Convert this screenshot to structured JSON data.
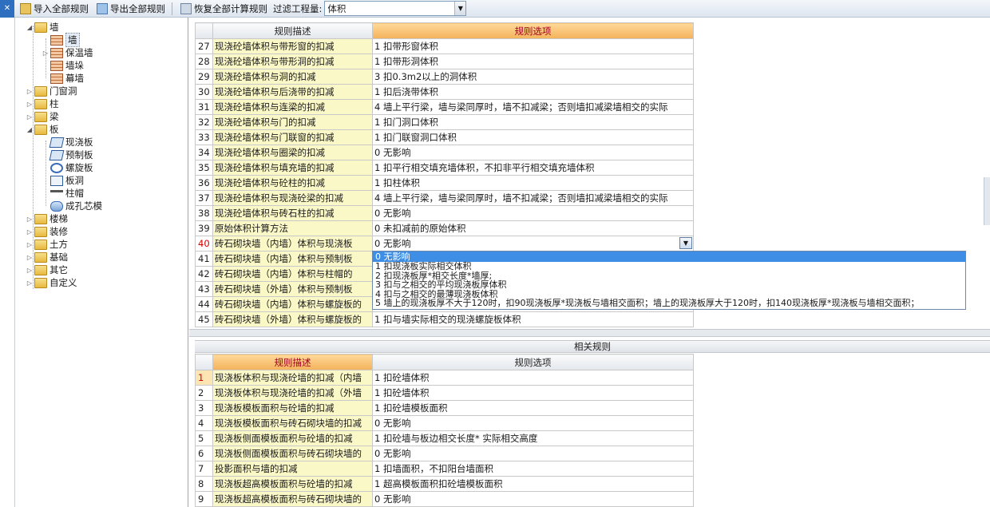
{
  "toolbar": {
    "import_label": "导入全部规则",
    "export_label": "导出全部规则",
    "restore_label": "恢复全部计算规则",
    "filter_label": "过滤工程量:",
    "filter_value": "体积"
  },
  "tree": {
    "wall": "墙",
    "wall_children": [
      "墙",
      "保温墙",
      "墙垛",
      "幕墙"
    ],
    "door_window": "门窗洞",
    "column": "柱",
    "beam": "梁",
    "slab": "板",
    "slab_children": [
      "现浇板",
      "预制板",
      "螺旋板",
      "板洞",
      "柱帽",
      "成孔芯模"
    ],
    "stairs": "楼梯",
    "decoration": "装修",
    "earthwork": "土方",
    "foundation": "基础",
    "other": "其它",
    "custom": "自定义"
  },
  "main_grid": {
    "header_desc": "规则描述",
    "header_opt": "规则选项",
    "rows": [
      {
        "n": "27",
        "desc": "现浇砼墙体积与带形窗的扣减",
        "opt": "1  扣带形窗体积"
      },
      {
        "n": "28",
        "desc": "现浇砼墙体积与带形洞的扣减",
        "opt": "1  扣带形洞体积"
      },
      {
        "n": "29",
        "desc": "现浇砼墙体积与洞的扣减",
        "opt": "3  扣0.3m2以上的洞体积"
      },
      {
        "n": "30",
        "desc": "现浇砼墙体积与后浇带的扣减",
        "opt": "1      扣后浇带体积"
      },
      {
        "n": "31",
        "desc": "现浇砼墙体积与连梁的扣减",
        "opt": "4    墙上平行梁，墙与梁同厚时，墙不扣减梁；否则墙扣减梁墙相交的实际"
      },
      {
        "n": "32",
        "desc": "现浇砼墙体积与门的扣减",
        "opt": "1  扣门洞口体积"
      },
      {
        "n": "33",
        "desc": "现浇砼墙体积与门联窗的扣减",
        "opt": "1  扣门联窗洞口体积"
      },
      {
        "n": "34",
        "desc": "现浇砼墙体积与圈梁的扣减",
        "opt": "0    无影响"
      },
      {
        "n": "35",
        "desc": "现浇砼墙体积与填充墙的扣减",
        "opt": "1  扣平行相交填充墙体积，不扣非平行相交填充墙体积"
      },
      {
        "n": "36",
        "desc": "现浇砼墙体积与砼柱的扣减",
        "opt": "1    扣柱体积"
      },
      {
        "n": "37",
        "desc": "现浇砼墙体积与现浇砼梁的扣减",
        "opt": "4    墙上平行梁，墙与梁同厚时，墙不扣减梁；否则墙扣减梁墙相交的实际"
      },
      {
        "n": "38",
        "desc": "现浇砼墙体积与砖石柱的扣减",
        "opt": "0    无影响"
      },
      {
        "n": "39",
        "desc": "原始体积计算方法",
        "opt": "0  未扣减前的原始体积"
      },
      {
        "n": "40",
        "desc": "砖石砌块墙（内墙）体积与现浇板",
        "opt": "0    无影响"
      },
      {
        "n": "41",
        "desc": "砖石砌块墙（内墙）体积与预制板",
        "opt": ""
      },
      {
        "n": "42",
        "desc": "砖石砌块墙（内墙）体积与柱帽的",
        "opt": ""
      },
      {
        "n": "43",
        "desc": "砖石砌块墙（外墙）体积与预制板",
        "opt": ""
      },
      {
        "n": "44",
        "desc": "砖石砌块墙（内墙）体积与螺旋板的",
        "opt": ""
      },
      {
        "n": "45",
        "desc": "砖石砌块墙（外墙）体积与螺旋板的",
        "opt": "1    扣与墙实际相交的现浇螺旋板体积"
      }
    ]
  },
  "dropdown": {
    "options": [
      "0    无影响",
      "1    扣现浇板实际相交体积",
      "2    扣现浇板厚*相交长度*墙厚;",
      "3    扣与之相交的平均现浇板厚体积",
      "4    扣与之相交的最薄现浇板体积",
      "5    墙上的现浇板厚不大于120时，扣90现浇板厚*现浇板与墙相交面积；墙上的现浇板厚大于120时，扣140现浇板厚*现浇板与墙相交面积；"
    ]
  },
  "related": {
    "title": "相关规则",
    "header_desc": "规则描述",
    "header_opt": "规则选项",
    "rows": [
      {
        "n": "1",
        "desc": "现浇板体积与现浇砼墙的扣减（内墙",
        "opt": "1    扣砼墙体积"
      },
      {
        "n": "2",
        "desc": "现浇板体积与现浇砼墙的扣减（外墙",
        "opt": "1    扣砼墙体积"
      },
      {
        "n": "3",
        "desc": "现浇板模板面积与砼墙的扣减",
        "opt": "1    扣砼墙模板面积"
      },
      {
        "n": "4",
        "desc": "现浇板模板面积与砖石砌块墙的扣减",
        "opt": "0    无影响"
      },
      {
        "n": "5",
        "desc": "现浇板侧面模板面积与砼墙的扣减",
        "opt": "1    扣砼墙与板边相交长度* 实际相交高度"
      },
      {
        "n": "6",
        "desc": "现浇板侧面模板面积与砖石砌块墙的",
        "opt": "0    无影响"
      },
      {
        "n": "7",
        "desc": "投影面积与墙的扣减",
        "opt": "1    扣墙面积，不扣阳台墙面积"
      },
      {
        "n": "8",
        "desc": "现浇板超高模板面积与砼墙的扣减",
        "opt": "1    超高模板面积扣砼墙模板面积"
      },
      {
        "n": "9",
        "desc": "现浇板超高模板面积与砖石砌块墙的",
        "opt": "0    无影响"
      }
    ]
  }
}
